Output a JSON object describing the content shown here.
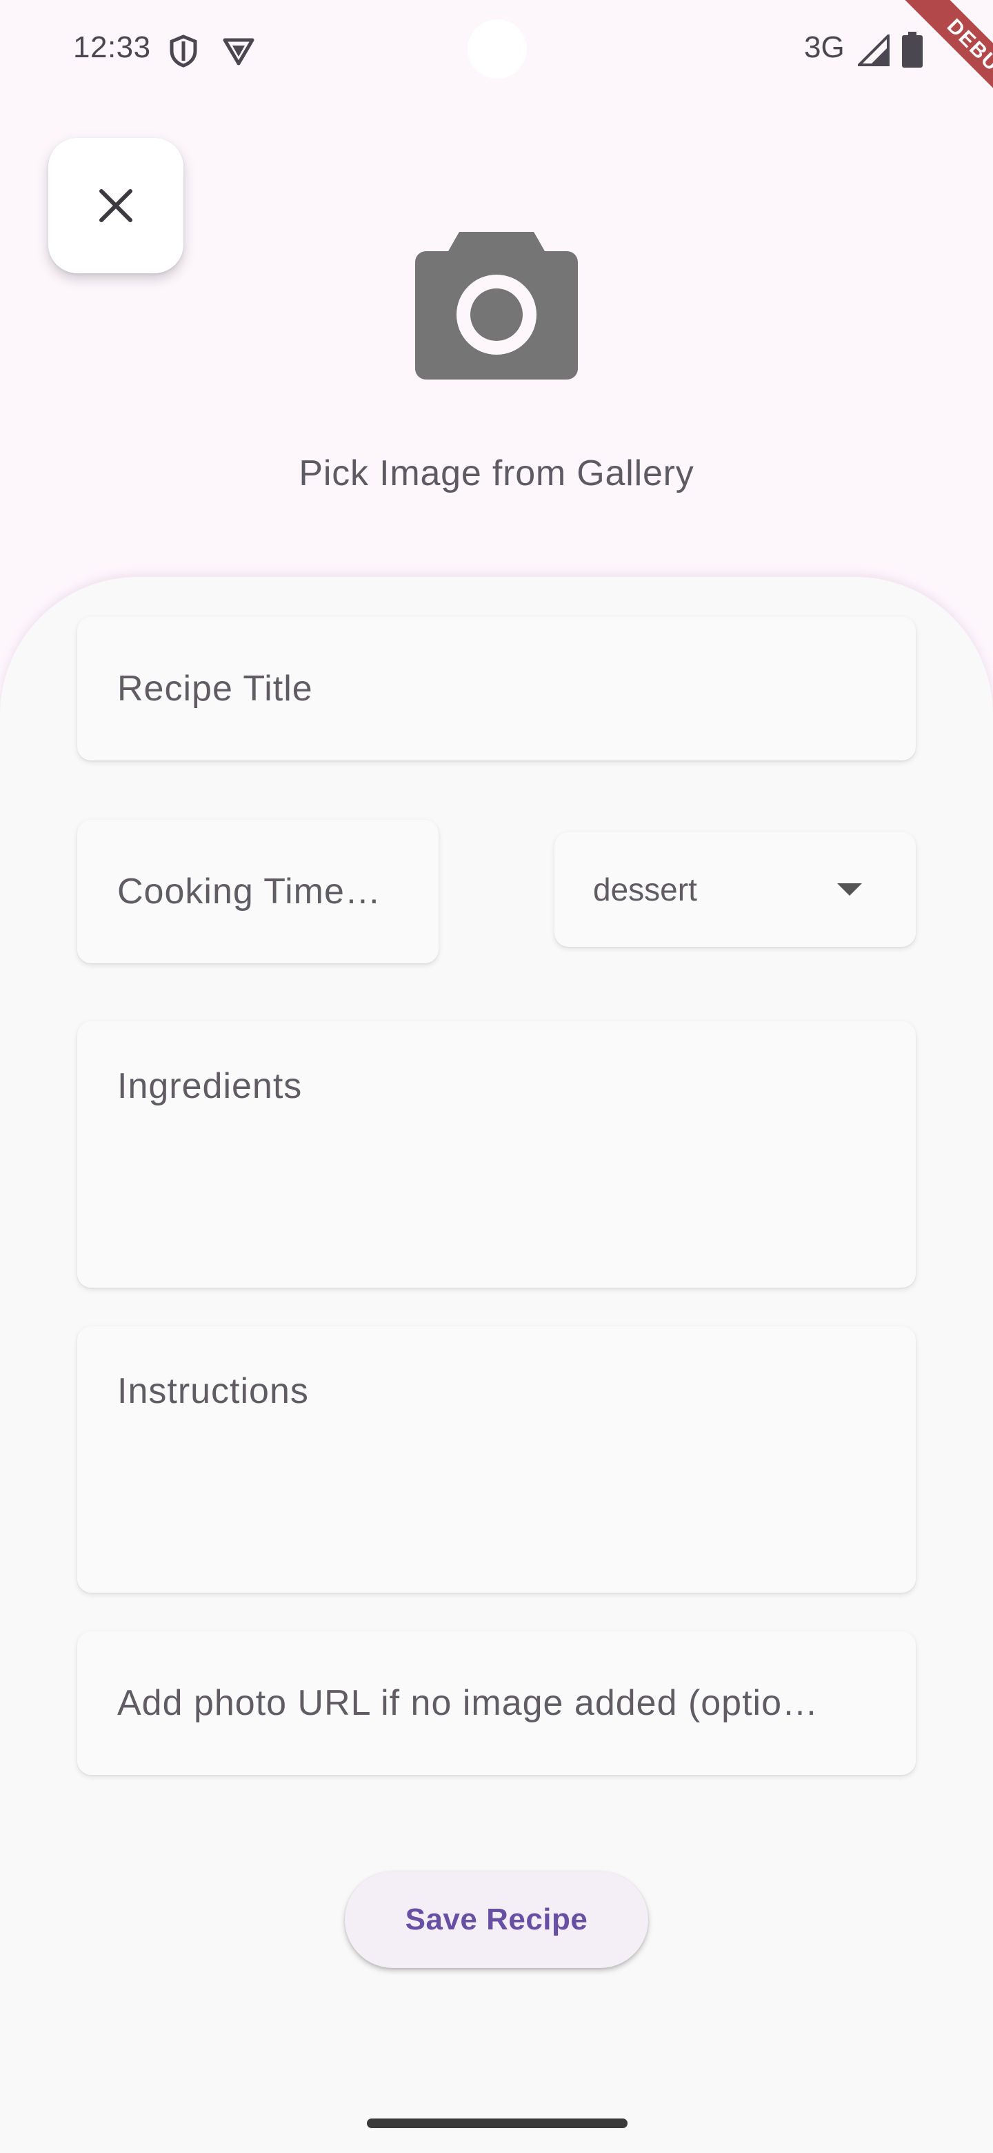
{
  "status_bar": {
    "time": "12:33",
    "network": "3G",
    "icons": [
      "shield-icon",
      "vpn-icon",
      "signal-icon",
      "battery-icon"
    ]
  },
  "debug_banner": {
    "label": "DEBUG",
    "color": "#a52a2a"
  },
  "header": {
    "close_icon": "close-icon",
    "camera_icon": "camera-icon",
    "pick_image_label": "Pick Image from Gallery"
  },
  "form": {
    "title_placeholder": "Recipe Title",
    "cooking_time_placeholder": "Cooking Time…",
    "category": {
      "selected": "dessert",
      "icon": "arrow-drop-down-icon"
    },
    "ingredients_placeholder": "Ingredients",
    "instructions_placeholder": "Instructions",
    "photo_url_placeholder": "Add photo URL if no image added (optio…"
  },
  "actions": {
    "save_label": "Save Recipe"
  },
  "colors": {
    "background": "#fdf7fc",
    "sheet": "#f9f9f9",
    "accent": "#6750a4",
    "debug": "#a52a2a"
  }
}
